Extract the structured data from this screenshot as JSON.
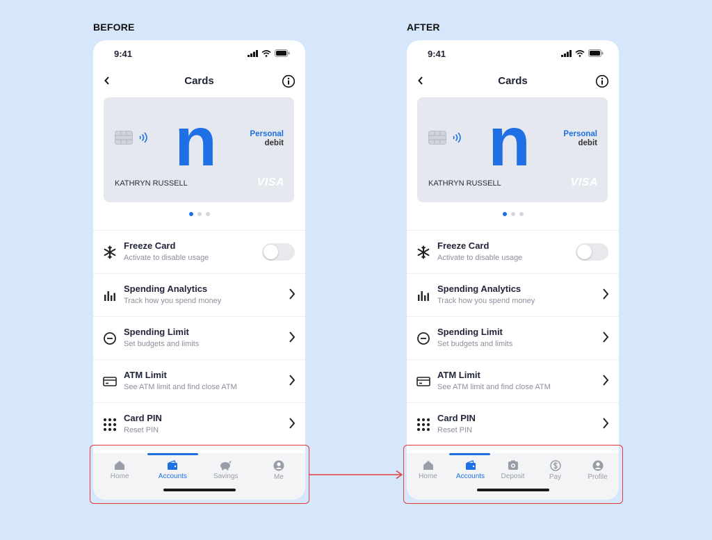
{
  "captions": {
    "before": "BEFORE",
    "after": "AFTER"
  },
  "status": {
    "time": "9:41"
  },
  "screen": {
    "title": "Cards"
  },
  "card": {
    "type_line1": "Personal",
    "type_line2": "debit",
    "holder": "KATHRYN RUSSELL",
    "network": "VISA",
    "brand_glyph": "n",
    "brand_color": "#1f6fe5"
  },
  "rows": [
    {
      "title": "Freeze Card",
      "subtitle": "Activate to disable usage",
      "icon": "snowflake-icon",
      "control": "toggle",
      "toggle_on": false
    },
    {
      "title": "Spending Analytics",
      "subtitle": "Track how you spend money",
      "icon": "bar-chart-icon",
      "control": "chevron"
    },
    {
      "title": "Spending Limit",
      "subtitle": "Set budgets and limits",
      "icon": "minus-circle-icon",
      "control": "chevron"
    },
    {
      "title": "ATM Limit",
      "subtitle": "See ATM limit and find close ATM",
      "icon": "card-icon",
      "control": "chevron"
    },
    {
      "title": "Card PIN",
      "subtitle": "Reset PIN",
      "icon": "keypad-icon",
      "control": "chevron"
    }
  ],
  "before": {
    "tabs": [
      {
        "label": "Home",
        "icon": "home-icon"
      },
      {
        "label": "Accounts",
        "icon": "wallet-icon",
        "active": true
      },
      {
        "label": "Savings",
        "icon": "piggy-bank-icon"
      },
      {
        "label": "Me",
        "icon": "profile-icon"
      }
    ]
  },
  "after": {
    "tabs": [
      {
        "label": "Home",
        "icon": "home-icon"
      },
      {
        "label": "Accounts",
        "icon": "wallet-icon",
        "active": true
      },
      {
        "label": "Deposit",
        "icon": "deposit-icon"
      },
      {
        "label": "Pay",
        "icon": "dollar-coin-icon"
      },
      {
        "label": "Profile",
        "icon": "profile-icon"
      }
    ]
  },
  "colors": {
    "accent": "#1f6fe5",
    "highlight": "#e23a3a",
    "background": "#d6e6fb"
  }
}
